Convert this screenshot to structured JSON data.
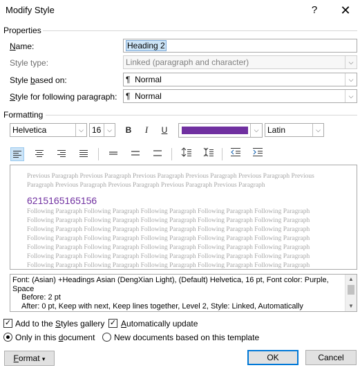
{
  "window": {
    "title": "Modify Style",
    "help_glyph": "?",
    "close_glyph": "✕"
  },
  "properties": {
    "section_label": "Properties",
    "name_label": "Name:",
    "name_value": "Heading 2",
    "style_type_label": "Style type:",
    "style_type_value": "Linked (paragraph and character)",
    "based_on_label": "Style based on:",
    "based_on_value": "Normal",
    "following_label": "Style for following paragraph:",
    "following_value": "Normal",
    "paragraph_mark": "¶"
  },
  "formatting": {
    "section_label": "Formatting",
    "font": "Helvetica",
    "size": "16",
    "bold": "B",
    "italic": "I",
    "underline": "U",
    "font_color": "#7030a0",
    "script": "Latin"
  },
  "preview": {
    "previous_lines": [
      "Previous Paragraph Previous Paragraph Previous Paragraph Previous Paragraph Previous Paragraph Previous",
      "Paragraph Previous Paragraph Previous Paragraph Previous Paragraph Previous Paragraph"
    ],
    "sample_text": "6215165165156",
    "following_lines": [
      "Following Paragraph Following Paragraph Following Paragraph Following Paragraph Following Paragraph",
      "Following Paragraph Following Paragraph Following Paragraph Following Paragraph Following Paragraph",
      "Following Paragraph Following Paragraph Following Paragraph Following Paragraph Following Paragraph",
      "Following Paragraph Following Paragraph Following Paragraph Following Paragraph Following Paragraph",
      "Following Paragraph Following Paragraph Following Paragraph Following Paragraph Following Paragraph",
      "Following Paragraph Following Paragraph Following Paragraph Following Paragraph Following Paragraph",
      "Following Paragraph Following Paragraph Following Paragraph Following Paragraph Following Paragraph"
    ]
  },
  "description": {
    "line1": "Font: (Asian) +Headings Asian (DengXian Light), (Default) Helvetica, 16 pt, Font color: Purple,",
    "line2": "Space",
    "line3": "Before:  2 pt",
    "line4": "After:  0 pt, Keep with next, Keep lines together, Level 2, Style: Linked, Automatically"
  },
  "options": {
    "add_to_gallery": "Add to the Styles gallery",
    "add_to_gallery_checked": true,
    "auto_update": "Automatically update",
    "auto_update_checked": true,
    "only_this_document": "Only in this document",
    "new_documents": "New documents based on this template",
    "selected_scope": "only_this_document"
  },
  "buttons": {
    "format": "Format",
    "ok": "OK",
    "cancel": "Cancel"
  },
  "glyphs": {
    "dropdown": "⌵",
    "small_down": "▾",
    "check": "✓"
  }
}
